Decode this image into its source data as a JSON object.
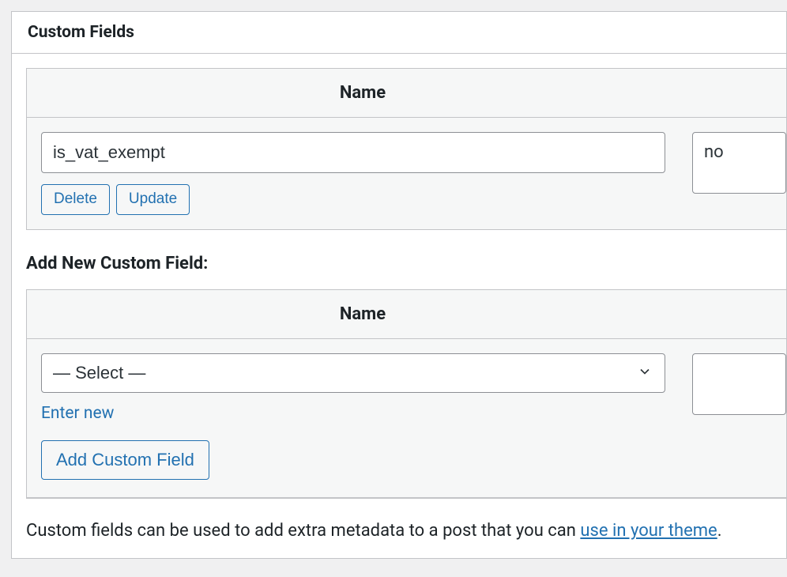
{
  "metabox": {
    "title": "Custom Fields"
  },
  "existing": {
    "header_name": "Name",
    "key": "is_vat_exempt",
    "value": "no",
    "delete_label": "Delete",
    "update_label": "Update"
  },
  "add_new": {
    "heading": "Add New Custom Field:",
    "header_name": "Name",
    "select_placeholder": "— Select —",
    "value": "",
    "enter_new_label": "Enter new",
    "add_button_label": "Add Custom Field"
  },
  "footer": {
    "text_before": "Custom fields can be used to add extra metadata to a post that you can ",
    "link_text": "use in your theme",
    "text_after": "."
  }
}
